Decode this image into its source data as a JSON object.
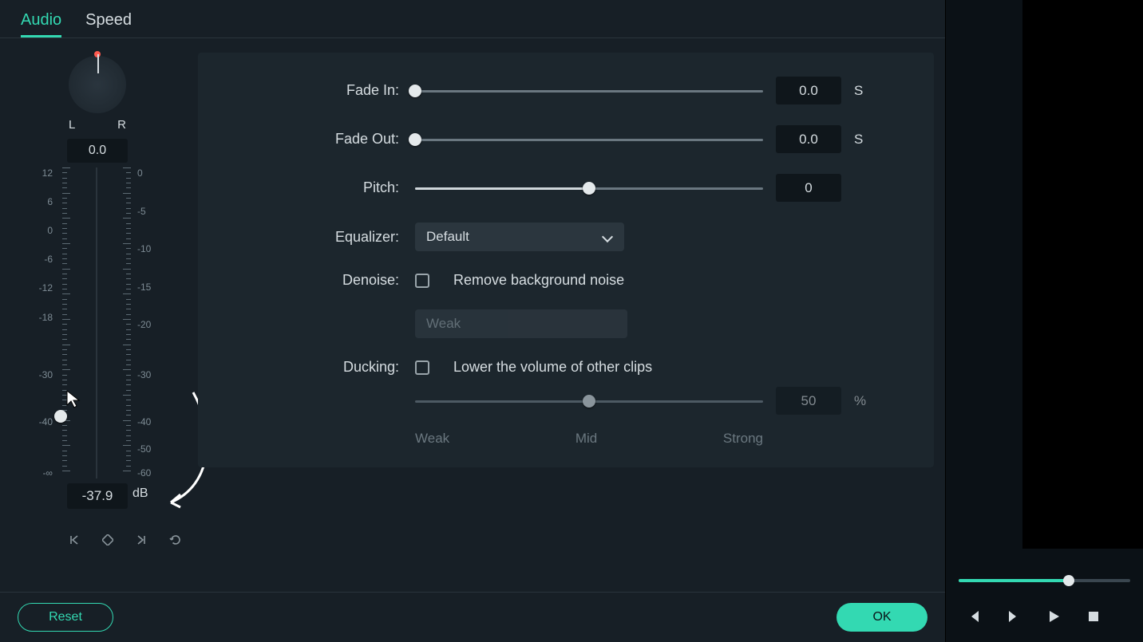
{
  "tabs": {
    "audio": "Audio",
    "speed": "Speed",
    "active": "audio"
  },
  "pan": {
    "left": "L",
    "right": "R",
    "value": "0.0"
  },
  "vu": {
    "left_ticks": [
      "12",
      "6",
      "0",
      "-6",
      "-12",
      "-18",
      "-30",
      "-40",
      "-∞"
    ],
    "right_ticks": [
      "0",
      "-5",
      "-10",
      "-15",
      "-20",
      "-30",
      "-40",
      "-50",
      "-60"
    ],
    "db_value": "-37.9",
    "db_unit": "dB",
    "handle_percent": 82
  },
  "params": {
    "fade_in": {
      "label": "Fade In:",
      "value": "0.0",
      "unit": "S",
      "percent": 0
    },
    "fade_out": {
      "label": "Fade Out:",
      "value": "0.0",
      "unit": "S",
      "percent": 0
    },
    "pitch": {
      "label": "Pitch:",
      "value": "0",
      "percent": 50
    },
    "equalizer": {
      "label": "Equalizer:",
      "value": "Default"
    },
    "denoise": {
      "label": "Denoise:",
      "check_label": "Remove background noise",
      "strength": "Weak"
    },
    "ducking": {
      "label": "Ducking:",
      "check_label": "Lower the volume of other clips",
      "value": "50",
      "unit": "%",
      "percent": 50,
      "weak": "Weak",
      "mid": "Mid",
      "strong": "Strong"
    }
  },
  "footer": {
    "reset": "Reset",
    "ok": "OK"
  },
  "player": {
    "progress_percent": 64
  }
}
